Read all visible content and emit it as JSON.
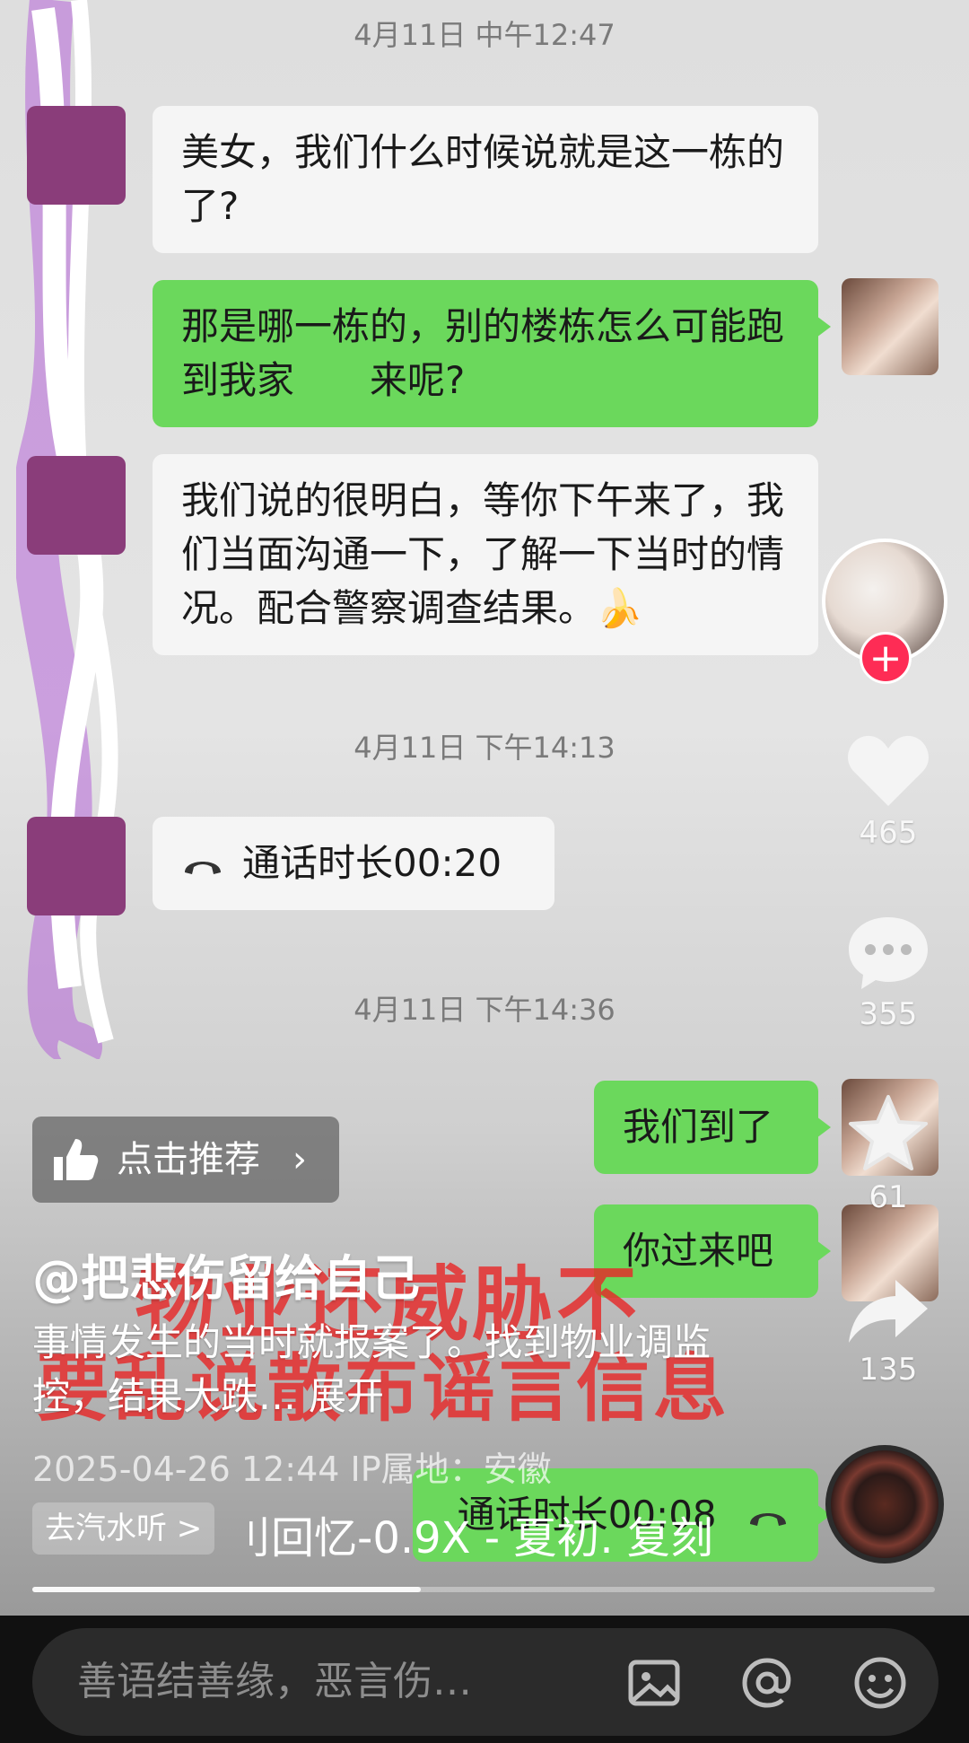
{
  "timestamps": [
    "4月11日 中午12:47",
    "4月11日 下午14:13",
    "4月11日 下午14:36"
  ],
  "messages": {
    "m1": "美女，我们什么时候说就是这一栋的了?",
    "m2": "那是哪一栋的，别的楼栋怎么可能跑到我家　　来呢?",
    "m3": "我们说的很明白，等你下午来了，我们当面沟通一下，了解一下当时的情况。配合警察调查结果。🍌",
    "call1": "通话时长00:20",
    "m4": "我们到了",
    "m5": "你过来吧",
    "call2": "通话时长00:08"
  },
  "actions": {
    "like_count": "465",
    "comment_count": "355",
    "favorite_count": "61",
    "share_count": "135"
  },
  "recommend_label": "点击推荐",
  "author": "@把悲伤留给自己",
  "overlay_text": {
    "line1": "物业还威胁不",
    "line2": "要乱说散布谣言信息"
  },
  "description": {
    "text": "事情发生的当时就报案了。找到物业调监控，结果大跌…",
    "expand": "展开"
  },
  "meta": "2025-04-26 12:44  IP属地：安徽",
  "music": {
    "tag": "去汽水听 >",
    "text": "刂回忆-0.9X - 夏初.  复刻"
  },
  "progress": 0.43,
  "comment_placeholder": "善语结善缘，恶言伤…",
  "colors": {
    "green_bubble": "#6bd85c",
    "white_bubble": "#f5f5f5",
    "follow_red": "#fe2c55",
    "overlay_red": "#e62828"
  },
  "icons": [
    "phone-icon",
    "thumbs-up-icon",
    "chevron-right-icon",
    "heart-icon",
    "comment-icon",
    "star-icon",
    "share-icon",
    "image-icon",
    "at-icon",
    "emoji-icon"
  ]
}
